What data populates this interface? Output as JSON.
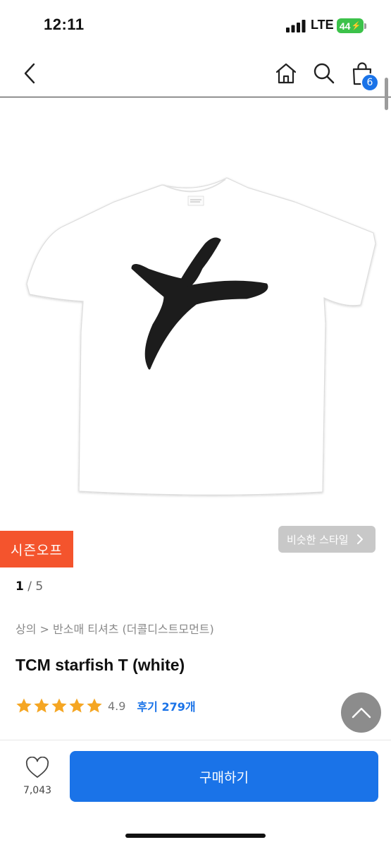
{
  "status_bar": {
    "time": "12:11",
    "network": "LTE",
    "battery": "44"
  },
  "header": {
    "cart_count": "6",
    "icons": [
      "chevron-left-icon",
      "home-icon",
      "search-icon",
      "shopping-bag-icon"
    ]
  },
  "product": {
    "season_badge": "시즌오프",
    "similar_style_label": "비슷한 스타일",
    "image_page": "1",
    "image_total": "/ 5",
    "breadcrumb": "상의 > 반소매 티셔츠 (더콜디스트모먼트)",
    "title": "TCM starfish T (white)",
    "rating": 4.9,
    "rating_text": "4.9",
    "review_label": "후기 279개"
  },
  "footer": {
    "like_count": "7,043",
    "buy_label": "구매하기"
  },
  "colors": {
    "accent": "#1a73e8",
    "sale_badge": "#f4542d",
    "star": "#f5a623"
  }
}
